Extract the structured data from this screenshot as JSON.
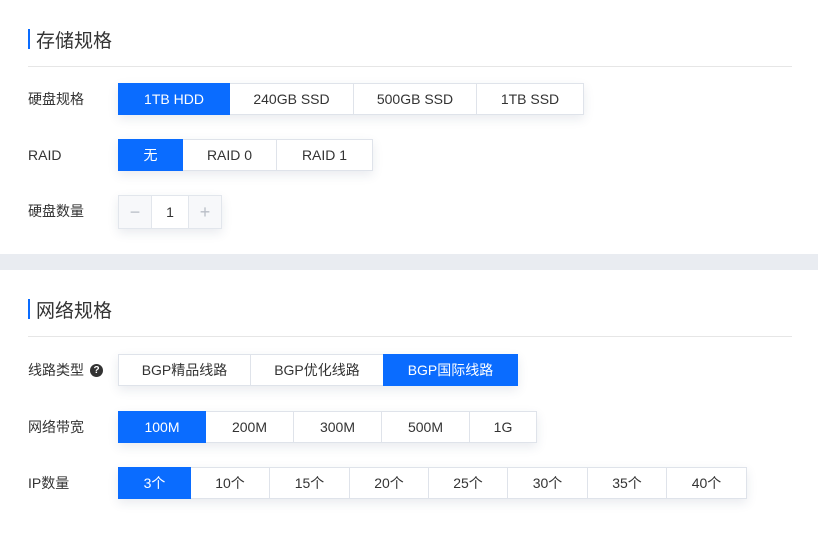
{
  "storage": {
    "title": "存储规格",
    "disk_spec": {
      "label": "硬盘规格",
      "options": [
        "1TB HDD",
        "240GB SSD",
        "500GB SSD",
        "1TB SSD"
      ],
      "selected": "1TB HDD"
    },
    "raid": {
      "label": "RAID",
      "options": [
        "无",
        "RAID 0",
        "RAID 1"
      ],
      "selected": "无"
    },
    "disk_count": {
      "label": "硬盘数量",
      "minus": "−",
      "value": "1",
      "plus": "+"
    }
  },
  "network": {
    "title": "网络规格",
    "line_type": {
      "label": "线路类型",
      "help_icon": "?",
      "options": [
        "BGP精品线路",
        "BGP优化线路",
        "BGP国际线路"
      ],
      "selected": "BGP国际线路"
    },
    "bandwidth": {
      "label": "网络带宽",
      "options": [
        "100M",
        "200M",
        "300M",
        "500M",
        "1G"
      ],
      "selected": "100M"
    },
    "ip_count": {
      "label": "IP数量",
      "options": [
        "3个",
        "10个",
        "15个",
        "20个",
        "25个",
        "30个",
        "35个",
        "40个"
      ],
      "selected": "3个"
    }
  },
  "colors": {
    "accent": "#0a6cff",
    "background": "#e9ecf1",
    "panel": "#ffffff"
  }
}
